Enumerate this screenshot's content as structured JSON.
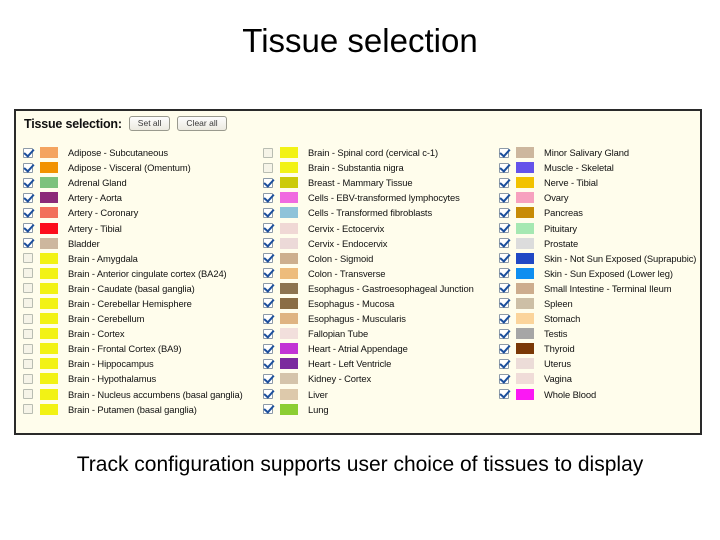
{
  "slide": {
    "title": "Tissue selection",
    "caption": "Track configuration supports user choice of tissues to display"
  },
  "panel": {
    "header_label": "Tissue selection:",
    "set_all_label": "Set all",
    "clear_all_label": "Clear all",
    "background_color": "#fffdec",
    "border_color": "#2a2a2a",
    "columns": [
      {
        "name": "column-1",
        "items": [
          {
            "label": "Adipose - Subcutaneous",
            "color": "#f4a460",
            "checked": true
          },
          {
            "label": "Adipose - Visceral (Omentum)",
            "color": "#f29200",
            "checked": true
          },
          {
            "label": "Adrenal Gland",
            "color": "#7cc27c",
            "checked": true
          },
          {
            "label": "Artery - Aorta",
            "color": "#8b2a78",
            "checked": true
          },
          {
            "label": "Artery - Coronary",
            "color": "#f2705a",
            "checked": true
          },
          {
            "label": "Artery - Tibial",
            "color": "#fc0d1b",
            "checked": true
          },
          {
            "label": "Bladder",
            "color": "#cdb79e",
            "checked": true
          },
          {
            "label": "Brain - Amygdala",
            "color": "#f2f215",
            "checked": false
          },
          {
            "label": "Brain - Anterior cingulate cortex (BA24)",
            "color": "#f2f215",
            "checked": false
          },
          {
            "label": "Brain - Caudate (basal ganglia)",
            "color": "#f2f215",
            "checked": false
          },
          {
            "label": "Brain - Cerebellar Hemisphere",
            "color": "#f2f215",
            "checked": false
          },
          {
            "label": "Brain - Cerebellum",
            "color": "#f2f215",
            "checked": false
          },
          {
            "label": "Brain - Cortex",
            "color": "#f2f215",
            "checked": false
          },
          {
            "label": "Brain - Frontal Cortex (BA9)",
            "color": "#f2f215",
            "checked": false
          },
          {
            "label": "Brain - Hippocampus",
            "color": "#f2f215",
            "checked": false
          },
          {
            "label": "Brain - Hypothalamus",
            "color": "#f2f215",
            "checked": false
          },
          {
            "label": "Brain - Nucleus accumbens (basal ganglia)",
            "color": "#f2f215",
            "checked": false
          },
          {
            "label": "Brain - Putamen (basal ganglia)",
            "color": "#f2f215",
            "checked": false
          }
        ]
      },
      {
        "name": "column-2",
        "items": [
          {
            "label": "Brain - Spinal cord (cervical c-1)",
            "color": "#f2f215",
            "checked": false
          },
          {
            "label": "Brain - Substantia nigra",
            "color": "#f2f215",
            "checked": false
          },
          {
            "label": "Breast - Mammary Tissue",
            "color": "#ccca08",
            "checked": true
          },
          {
            "label": "Cells - EBV-transformed lymphocytes",
            "color": "#f06ae0",
            "checked": true
          },
          {
            "label": "Cells - Transformed fibroblasts",
            "color": "#8fc3d9",
            "checked": true
          },
          {
            "label": "Cervix - Ectocervix",
            "color": "#f0d8d5",
            "checked": true
          },
          {
            "label": "Cervix - Endocervix",
            "color": "#ecd9d8",
            "checked": true
          },
          {
            "label": "Colon - Sigmoid",
            "color": "#cdaf8e",
            "checked": true
          },
          {
            "label": "Colon - Transverse",
            "color": "#edbc7c",
            "checked": true
          },
          {
            "label": "Esophagus - Gastroesophageal Junction",
            "color": "#8d7450",
            "checked": true
          },
          {
            "label": "Esophagus - Mucosa",
            "color": "#8a6d45",
            "checked": true
          },
          {
            "label": "Esophagus - Muscularis",
            "color": "#dfb482",
            "checked": true
          },
          {
            "label": "Fallopian Tube",
            "color": "#f2dfdc",
            "checked": true
          },
          {
            "label": "Heart - Atrial Appendage",
            "color": "#c234d5",
            "checked": true
          },
          {
            "label": "Heart - Left Ventricle",
            "color": "#7b2a9e",
            "checked": true
          },
          {
            "label": "Kidney - Cortex",
            "color": "#d5c4ab",
            "checked": true
          },
          {
            "label": "Liver",
            "color": "#ddc9ab",
            "checked": true
          },
          {
            "label": "Lung",
            "color": "#8cce33",
            "checked": true
          }
        ]
      },
      {
        "name": "column-3",
        "items": [
          {
            "label": "Minor Salivary Gland",
            "color": "#cdb79e",
            "checked": true
          },
          {
            "label": "Muscle - Skeletal",
            "color": "#6553ea",
            "checked": true
          },
          {
            "label": "Nerve - Tibial",
            "color": "#f2c200",
            "checked": true
          },
          {
            "label": "Ovary",
            "color": "#f7a1bf",
            "checked": true
          },
          {
            "label": "Pancreas",
            "color": "#c78b06",
            "checked": true
          },
          {
            "label": "Pituitary",
            "color": "#a6e8b2",
            "checked": true
          },
          {
            "label": "Prostate",
            "color": "#dcdcdc",
            "checked": true
          },
          {
            "label": "Skin - Not Sun Exposed (Suprapubic)",
            "color": "#2148c4",
            "checked": true
          },
          {
            "label": "Skin - Sun Exposed (Lower leg)",
            "color": "#0f8ef0",
            "checked": true
          },
          {
            "label": "Small Intestine - Terminal Ileum",
            "color": "#cdad8e",
            "checked": true
          },
          {
            "label": "Spleen",
            "color": "#cdbfa6",
            "checked": true
          },
          {
            "label": "Stomach",
            "color": "#fbd49b",
            "checked": true
          },
          {
            "label": "Testis",
            "color": "#a6a6a6",
            "checked": true
          },
          {
            "label": "Thyroid",
            "color": "#7a3806",
            "checked": true
          },
          {
            "label": "Uterus",
            "color": "#ecdcd8",
            "checked": true
          },
          {
            "label": "Vagina",
            "color": "#f0dcd8",
            "checked": true
          },
          {
            "label": "Whole Blood",
            "color": "#fb18f4",
            "checked": true
          }
        ]
      }
    ]
  }
}
